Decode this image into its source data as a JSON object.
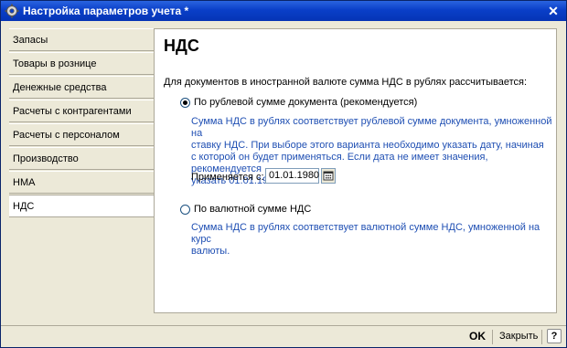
{
  "window": {
    "title": "Настройка параметров учета *"
  },
  "nav": {
    "items": [
      {
        "label": "Запасы"
      },
      {
        "label": "Товары в рознице"
      },
      {
        "label": "Денежные средства"
      },
      {
        "label": "Расчеты с контрагентами"
      },
      {
        "label": "Расчеты с персоналом"
      },
      {
        "label": "Производство"
      },
      {
        "label": "НМА"
      },
      {
        "label": "НДС",
        "active": true
      }
    ]
  },
  "panel": {
    "title": "НДС",
    "question": "Для документов в иностранной валюте сумма НДС в рублях рассчитывается:",
    "options": [
      {
        "label": "По рублевой сумме документа (рекомендуется)",
        "selected": true,
        "description_lines": [
          "Сумма НДС в рублях соответствует рублевой сумме документа, умноженной на",
          "ставку НДС. При выборе этого варианта необходимо указать дату, начиная",
          "с которой он будет применяться. Если дата не имеет значения, рекомендуется",
          "указать 01.01.1980."
        ]
      },
      {
        "label": "По валютной сумме НДС",
        "selected": false,
        "description_lines": [
          "Сумма НДС в рублях соответствует валютной сумме НДС, умноженной на курс",
          "валюты."
        ]
      }
    ],
    "date": {
      "label": "Применяется с:",
      "value": "01.01.1980",
      "button_icon": "calendar-icon"
    }
  },
  "footer": {
    "ok_label": "OK",
    "close_label": "Закрыть",
    "help_label": "?"
  },
  "colors": {
    "title_bar": "#0a3fc8",
    "description_text": "#1f4fb3",
    "window_bg": "#ece9d8"
  }
}
